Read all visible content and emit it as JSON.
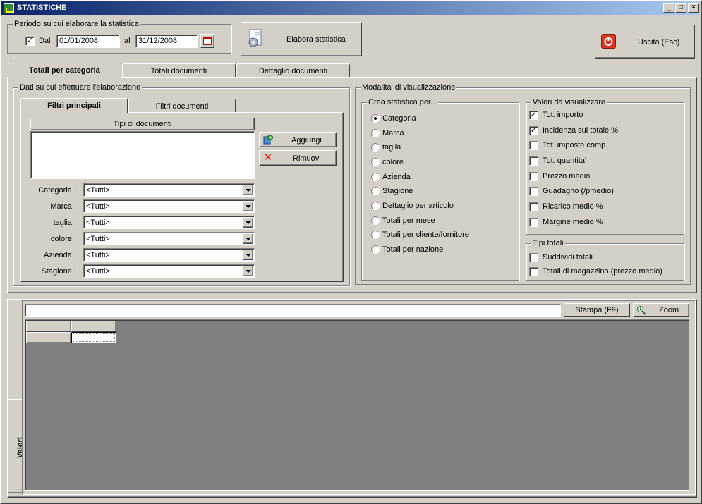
{
  "window": {
    "title": "STATISTICHE"
  },
  "period": {
    "legend": "Periodo su cui elaborare la statistica",
    "dal_label": "Dal",
    "dal_checked": true,
    "from": "01/01/2008",
    "al_label": "al",
    "to": "31/12/2008"
  },
  "toolbar": {
    "elabora_label": "Elabora statistica",
    "exit_label": "Uscita (Esc)"
  },
  "tabs": [
    {
      "label": "Totali per categoria",
      "active": true
    },
    {
      "label": "Totali documenti",
      "active": false
    },
    {
      "label": "Dettaglio documenti",
      "active": false
    }
  ],
  "data_group": {
    "legend": "Dati su cui effettuare l'elaborazione",
    "subtabs": [
      {
        "label": "Filtri principali",
        "active": true
      },
      {
        "label": "Filtri documenti",
        "active": false
      }
    ],
    "doc_types_header": "Tipi di documenti",
    "add_label": "Aggiungi",
    "remove_label": "Rimuovi",
    "filters": [
      {
        "label": "Categoria :",
        "value": "<Tutti>"
      },
      {
        "label": "Marca :",
        "value": "<Tutti>"
      },
      {
        "label": "taglia :",
        "value": "<Tutti>"
      },
      {
        "label": "colore :",
        "value": "<Tutti>"
      },
      {
        "label": "Azienda :",
        "value": "<Tutti>"
      },
      {
        "label": "Stagione :",
        "value": "<Tutti>"
      }
    ]
  },
  "view_group": {
    "legend": "Modalita' di visualizzazione",
    "crea_legend": "Crea statistica per...",
    "crea_options": [
      {
        "label": "Categoria",
        "selected": true
      },
      {
        "label": "Marca",
        "selected": false
      },
      {
        "label": "taglia",
        "selected": false
      },
      {
        "label": "colore",
        "selected": false
      },
      {
        "label": "Azienda",
        "selected": false
      },
      {
        "label": "Stagione",
        "selected": false
      },
      {
        "label": "Dettaglio per articolo",
        "selected": false
      },
      {
        "label": "Totali per mese",
        "selected": false
      },
      {
        "label": "Totali per cliente/fornitore",
        "selected": false
      },
      {
        "label": "Totali per nazione",
        "selected": false
      }
    ],
    "valori_legend": "Valori da visualizzare",
    "valori": [
      {
        "label": "Tot. importo",
        "checked": true
      },
      {
        "label": "Incidenza sul totale %",
        "checked": true
      },
      {
        "label": "Tot. imposte comp.",
        "checked": false
      },
      {
        "label": "Tot. quantita'",
        "checked": false
      },
      {
        "label": "Prezzo medio",
        "checked": false
      },
      {
        "label": "Guadagno (/pmedio)",
        "checked": false
      },
      {
        "label": "Ricarico medio %",
        "checked": false
      },
      {
        "label": "Margine medio %",
        "checked": false
      }
    ],
    "tipi_legend": "Tipi totali",
    "tipi": [
      {
        "label": "Suddividi totali",
        "checked": false
      },
      {
        "label": "Totali di magazzino (prezzo medio)",
        "checked": false
      }
    ]
  },
  "results": {
    "side_tab": "Valori",
    "search_value": "",
    "print_label": "Stampa (F9)",
    "zoom_label": "Zoom"
  }
}
